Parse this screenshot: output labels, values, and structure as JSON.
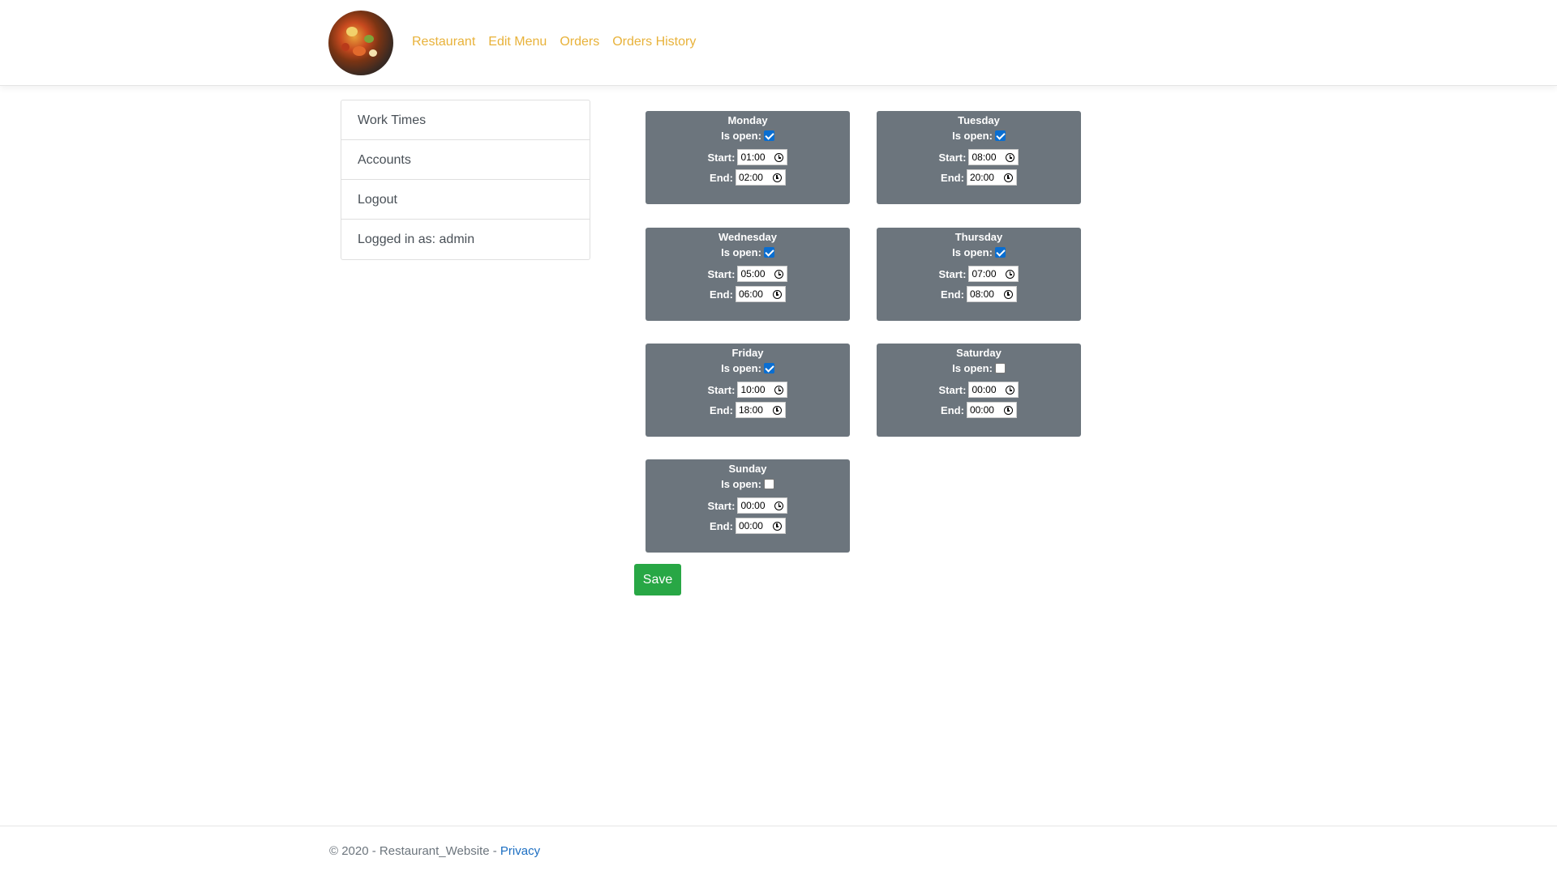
{
  "nav": {
    "links": [
      "Restaurant",
      "Edit Menu",
      "Orders",
      "Orders History"
    ]
  },
  "sidebar": {
    "items": [
      "Work Times",
      "Accounts",
      "Logout",
      "Logged in as: admin"
    ]
  },
  "labels": {
    "is_open": "Is open:",
    "start": "Start:",
    "end": "End:"
  },
  "days": [
    {
      "name": "Monday",
      "open": true,
      "start": "01:00",
      "end": "02:00"
    },
    {
      "name": "Tuesday",
      "open": true,
      "start": "08:00",
      "end": "20:00"
    },
    {
      "name": "Wednesday",
      "open": true,
      "start": "05:00",
      "end": "06:00"
    },
    {
      "name": "Thursday",
      "open": true,
      "start": "07:00",
      "end": "08:00"
    },
    {
      "name": "Friday",
      "open": true,
      "start": "10:00",
      "end": "18:00"
    },
    {
      "name": "Saturday",
      "open": false,
      "start": "00:00",
      "end": "00:00"
    },
    {
      "name": "Sunday",
      "open": false,
      "start": "00:00",
      "end": "00:00"
    }
  ],
  "save_label": "Save",
  "footer": {
    "copyright": "© 2020 - Restaurant_Website - ",
    "privacy": "Privacy"
  }
}
